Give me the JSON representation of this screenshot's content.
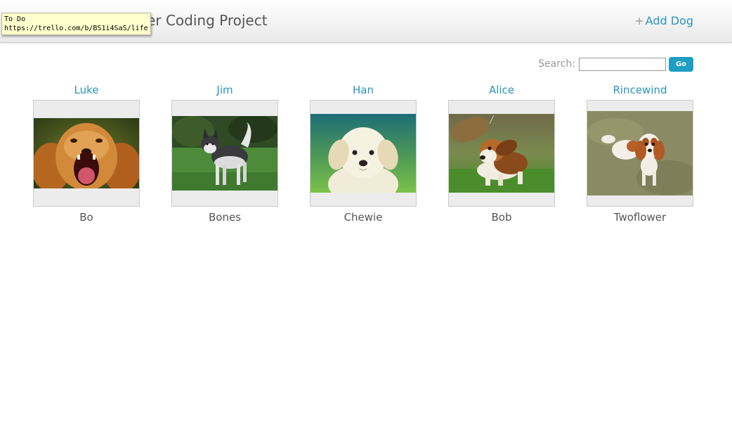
{
  "header": {
    "title": "Jon Pierce's Rover Coding Project",
    "add_dog_plus": "+",
    "add_dog_label": "Add Dog"
  },
  "tooltip": {
    "line1": "To Do",
    "line2": "https://trello.com/b/BS1i4SaS/life"
  },
  "search": {
    "label": "Search:",
    "value": "",
    "button_label": "Go"
  },
  "dogs": [
    {
      "name": "Luke",
      "owner": "Bo",
      "photo": "golden-retriever-yawning"
    },
    {
      "name": "Jim",
      "owner": "Bones",
      "photo": "alaskan-malamute"
    },
    {
      "name": "Han",
      "owner": "Chewie",
      "photo": "white-puppy"
    },
    {
      "name": "Alice",
      "owner": "Bob",
      "photo": "basset-hound-ears-flying"
    },
    {
      "name": "Rincewind",
      "owner": "Twoflower",
      "photo": "cavalier-king-charles-spaniel"
    }
  ],
  "colors": {
    "link": "#2a93bd",
    "button": "#1f9dc2",
    "tooltip_bg": "#ffffcc"
  }
}
